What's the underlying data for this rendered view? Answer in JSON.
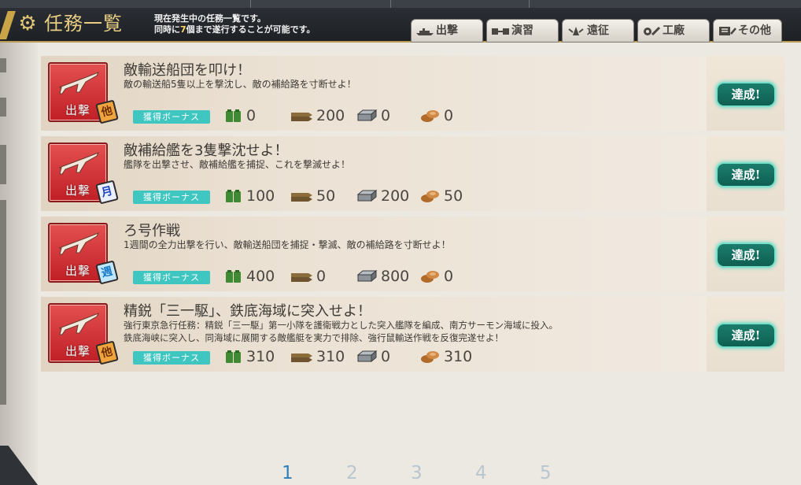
{
  "header": {
    "title": "任務一覧",
    "desc_line1": "現在発生中の任務一覧です。",
    "desc_line2_pre": "同時に",
    "desc_line2_num": "7",
    "desc_line2_post": "個まで遂行することが可能です。",
    "tabs": [
      {
        "label": "出撃",
        "icon": "battleship-icon"
      },
      {
        "label": "演習",
        "icon": "exercise-icon"
      },
      {
        "label": "遠征",
        "icon": "expedition-icon"
      },
      {
        "label": "工廠",
        "icon": "arsenal-icon"
      },
      {
        "label": "その他",
        "icon": "misc-icon"
      }
    ]
  },
  "quests": [
    {
      "title": "敵輸送船団を叩け！",
      "desc": "敵の輸送船5隻以上を撃沈し、敵の補給路を寸断せよ！",
      "desc2": "",
      "badge": "他",
      "category": "出撃",
      "bonus_label": "獲得ボーナス",
      "fuel": "0",
      "ammo": "200",
      "steel": "0",
      "bauxite": "0",
      "status": "達成!"
    },
    {
      "title": "敵補給艦を3隻撃沈せよ！",
      "desc": "艦隊を出撃させ、敵補給艦を捕捉、これを撃滅せよ！",
      "desc2": "",
      "badge": "月",
      "category": "出撃",
      "bonus_label": "獲得ボーナス",
      "fuel": "100",
      "ammo": "50",
      "steel": "200",
      "bauxite": "50",
      "status": "達成!"
    },
    {
      "title": "ろ号作戦",
      "desc": "1週間の全力出撃を行い、敵輸送船団を捕捉・撃滅、敵の補給路を寸断せよ！",
      "desc2": "",
      "badge": "週",
      "category": "出撃",
      "bonus_label": "獲得ボーナス",
      "fuel": "400",
      "ammo": "0",
      "steel": "800",
      "bauxite": "0",
      "status": "達成!"
    },
    {
      "title": "精鋭「三一駆」、鉄底海域に突入せよ！",
      "desc": "強行東京急行任務：精鋭「三一駆」第一小隊を護衛戦力とした突入艦隊を編成、南方サーモン海域に投入。",
      "desc2": "鉄底海峡に突入し、同海域に展開する敵艦艇を実力で排除、強行鼠輸送作戦を反復完遂せよ！",
      "badge": "他",
      "category": "出撃",
      "bonus_label": "獲得ボーナス",
      "fuel": "310",
      "ammo": "310",
      "steel": "0",
      "bauxite": "310",
      "status": "達成!"
    }
  ],
  "pager": {
    "pages": [
      "1",
      "2",
      "3",
      "4",
      "5"
    ],
    "current": "1"
  },
  "colors": {
    "sortie_red": "#c01f26",
    "bonus_teal": "#3fc6c0",
    "achieved_green": "#0e5f52",
    "active_page": "#2e7fb9"
  }
}
